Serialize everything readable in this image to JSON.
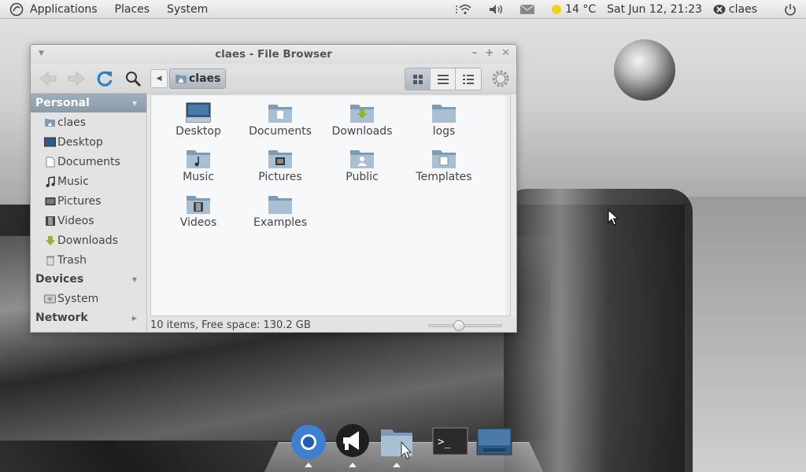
{
  "top_panel": {
    "menus": [
      "Applications",
      "Places",
      "System"
    ],
    "weather": "14 °C",
    "datetime": "Sat Jun 12, 21:23",
    "user": "claes",
    "icons": [
      "network-wireless-icon",
      "volume-icon",
      "mail-icon",
      "weather-sun-icon",
      "user-status-icon",
      "power-icon"
    ]
  },
  "window": {
    "title": "claes - File Browser",
    "path_button": "claes",
    "sidebar": {
      "personal": {
        "label": "Personal",
        "items": [
          "claes",
          "Desktop",
          "Documents",
          "Music",
          "Pictures",
          "Videos",
          "Downloads",
          "Trash"
        ]
      },
      "devices": {
        "label": "Devices",
        "items": [
          "System"
        ]
      },
      "network": {
        "label": "Network"
      }
    },
    "files": [
      "Desktop",
      "Documents",
      "Downloads",
      "logs",
      "Music",
      "Pictures",
      "Public",
      "Templates",
      "Videos",
      "Examples"
    ],
    "status": "10 items, Free space: 130.2 GB",
    "zoom_level": 0.4
  },
  "dock": {
    "items": [
      "chromium-icon",
      "gwibber-icon",
      "file-browser-icon",
      "terminal-icon",
      "desktop-icon"
    ]
  },
  "colors": {
    "selection": "#8f9fae",
    "folder": "#7f9ab4",
    "refresh": "#2b7fcf"
  }
}
